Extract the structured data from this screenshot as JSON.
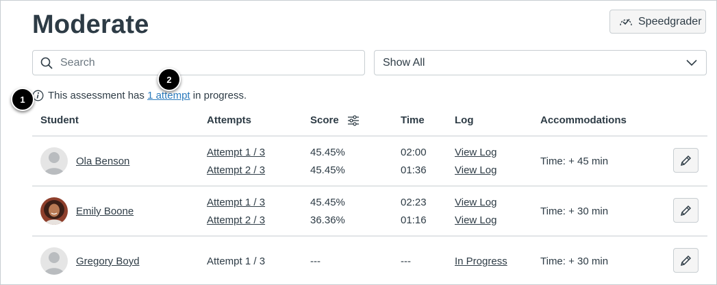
{
  "page": {
    "title": "Moderate"
  },
  "toolbar": {
    "speedgrader_label": "Speedgrader"
  },
  "search": {
    "placeholder": "Search"
  },
  "filter": {
    "selected": "Show All"
  },
  "notice": {
    "prefix": "This assessment has ",
    "link": "1 attempt",
    "suffix": " in progress."
  },
  "callouts": [
    "1",
    "2"
  ],
  "table": {
    "headers": {
      "student": "Student",
      "attempts": "Attempts",
      "score": "Score",
      "time": "Time",
      "log": "Log",
      "accommodations": "Accommodations"
    },
    "rows": [
      {
        "student": "Ola Benson",
        "attempts": [
          "Attempt 1 / 3",
          "Attempt 2 / 3"
        ],
        "scores": [
          "45.45%",
          "45.45%"
        ],
        "times": [
          "02:00",
          "01:36"
        ],
        "logs": [
          "View Log",
          "View Log"
        ],
        "accommodation": "Time: + 45 min"
      },
      {
        "student": "Emily Boone",
        "attempts": [
          "Attempt 1 / 3",
          "Attempt 2 / 3"
        ],
        "scores": [
          "45.45%",
          "36.36%"
        ],
        "times": [
          "02:23",
          "01:16"
        ],
        "logs": [
          "View Log",
          "View Log"
        ],
        "accommodation": "Time: + 30 min"
      },
      {
        "student": "Gregory Boyd",
        "attempts": [
          "Attempt 1 / 3"
        ],
        "scores": [
          "---"
        ],
        "times": [
          "---"
        ],
        "logs": [
          "In Progress"
        ],
        "accommodation": "Time: + 30 min"
      }
    ]
  },
  "colors": {
    "link": "#2b7abc",
    "text": "#2d3b45",
    "border": "#c7cdd1"
  }
}
